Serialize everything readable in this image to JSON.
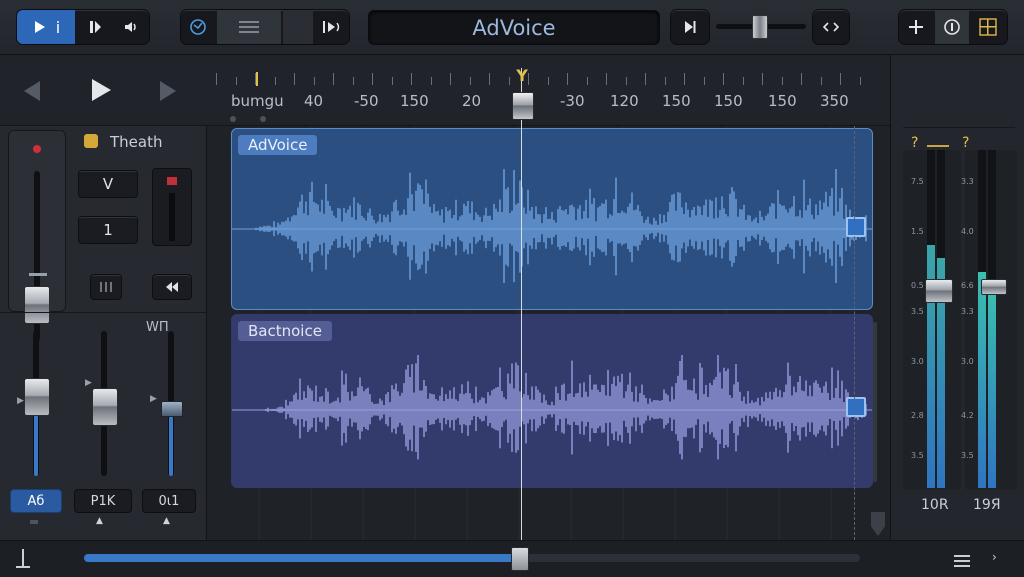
{
  "toolbar": {
    "title": "AdVoice",
    "transport_play_label": "i"
  },
  "ruler": {
    "start_label": "bumgu",
    "marks": [
      "40",
      "-50",
      "150",
      "20",
      "-30",
      "120",
      "150",
      "150",
      "150",
      "350"
    ]
  },
  "playhead": {
    "label": "Y"
  },
  "left_panel": {
    "channel_name": "Theath",
    "button_v": "V",
    "button_1": "1",
    "fader_top_label": "WΠ",
    "channels": [
      {
        "label": "Aб",
        "level": 0.55
      },
      {
        "label": "Ρ1Κ",
        "level": 0.48
      },
      {
        "label": "0ι1",
        "level": 0.47
      }
    ],
    "master_level": 0.25
  },
  "tracks": [
    {
      "name": "AdVoice",
      "color": "#2f5a91",
      "wave_color": "#6ea2e0"
    },
    {
      "name": "Bactnoice",
      "color": "#353f72",
      "wave_color": "#9a9ee0"
    }
  ],
  "right_panel": {
    "top_markers": [
      "?",
      "?"
    ],
    "scale_left": [
      "7.5",
      "1.5",
      "0.5",
      "3.5",
      "3.0",
      "2.8",
      "3.5"
    ],
    "scale_right": [
      "3.3",
      "4.0",
      "6.6",
      "3.3",
      "3.0",
      "4.2",
      "3.5"
    ],
    "meter_labels": [
      "10R",
      "19Я"
    ],
    "meter_levels": [
      0.72,
      0.64
    ],
    "accent_up": "#3ac26b"
  },
  "colors": {
    "accent": "#3a78c8",
    "playhead": "#e2c04c"
  },
  "scroll": {
    "position": 0.56
  }
}
